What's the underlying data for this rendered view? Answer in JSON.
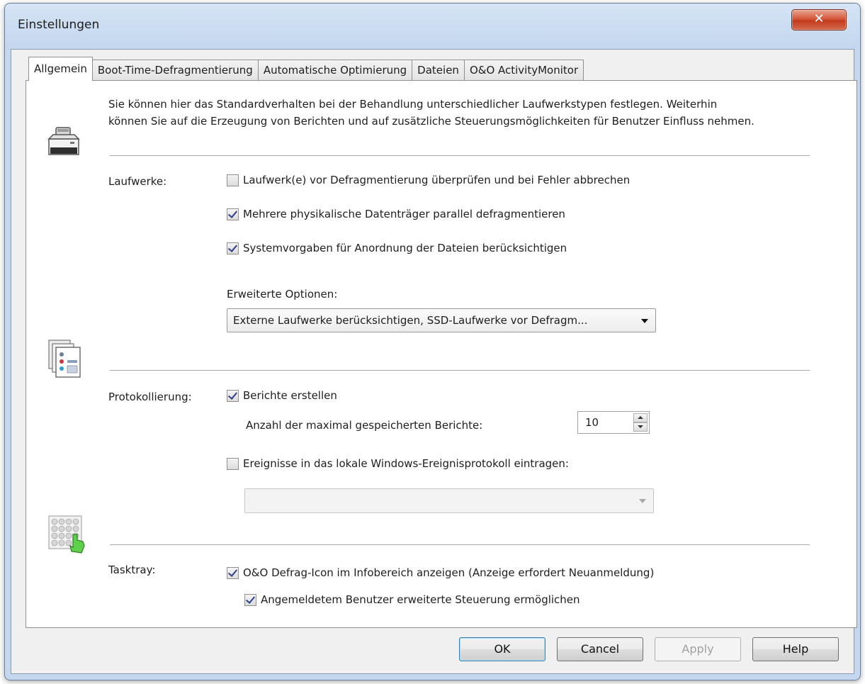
{
  "window": {
    "title": "Einstellungen",
    "close_glyph": "✕"
  },
  "tabs": [
    {
      "label": "Allgemein",
      "active": true
    },
    {
      "label": "Boot-Time-Defragmentierung",
      "active": false
    },
    {
      "label": "Automatische Optimierung",
      "active": false
    },
    {
      "label": "Dateien",
      "active": false
    },
    {
      "label": "O&O ActivityMonitor",
      "active": false
    }
  ],
  "intro": {
    "line1": "Sie können hier das Standardverhalten bei der Behandlung unterschiedlicher Laufwerkstypen festlegen. Weiterhin",
    "line2": "können Sie auf die Erzeugung von Berichten und auf zusätzliche Steuerungsmöglichkeiten für Benutzer Einfluss nehmen."
  },
  "drives": {
    "label": "Laufwerke:",
    "check_before": {
      "label": "Laufwerk(e) vor Defragmentierung überprüfen und bei Fehler abbrechen",
      "checked": false
    },
    "parallel": {
      "label": "Mehrere physikalische Datenträger parallel defragmentieren",
      "checked": true
    },
    "system_defaults": {
      "label": "Systemvorgaben für Anordnung der Dateien berücksichtigen",
      "checked": true
    },
    "advanced_label": "Erweiterte Optionen:",
    "advanced_value": "Externe Laufwerke berücksichtigen, SSD-Laufwerke vor Defragm..."
  },
  "logging": {
    "label": "Protokollierung:",
    "create_reports": {
      "label": "Berichte erstellen",
      "checked": true
    },
    "max_reports_label": "Anzahl der maximal gespeicherten Berichte:",
    "max_reports_value": "10",
    "event_log": {
      "label": "Ereignisse in das lokale Windows-Ereignisprotokoll eintragen:",
      "checked": false
    },
    "event_log_value": ""
  },
  "tasktray": {
    "label": "Tasktray:",
    "show_icon": {
      "label": "O&O Defrag-Icon im Infobereich anzeigen (Anzeige erfordert Neuanmeldung)",
      "checked": true
    },
    "extended_control": {
      "label": "Angemeldetem Benutzer erweiterte Steuerung ermöglichen",
      "checked": true
    }
  },
  "icons": {
    "drives": "drive-icon",
    "logging": "reports-icon",
    "tasktray": "tasktray-icon"
  },
  "buttons": {
    "ok": "OK",
    "cancel": "Cancel",
    "apply": "Apply",
    "help": "Help"
  }
}
